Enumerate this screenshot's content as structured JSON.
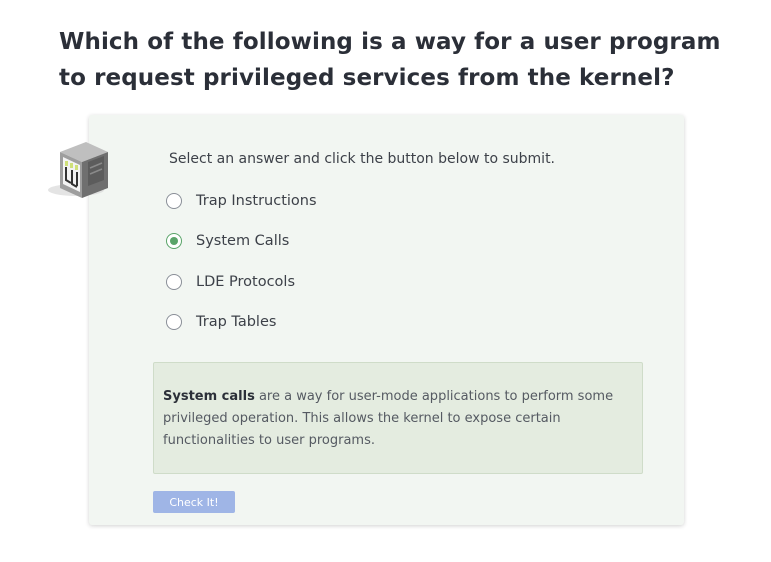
{
  "question": {
    "text": "Which of the following is a way for a user program to request privileged services from the kernel?"
  },
  "quiz": {
    "instructions": "Select an answer and click the button below to submit.",
    "options": [
      {
        "label": "Trap Instructions",
        "selected": false
      },
      {
        "label": "System Calls",
        "selected": true
      },
      {
        "label": "LDE Protocols",
        "selected": false
      },
      {
        "label": "Trap Tables",
        "selected": false
      }
    ],
    "feedback": {
      "term": "System calls",
      "text": " are a way for user-mode applications to perform some privileged operation. This allows the kernel to expose certain functionalities to user programs."
    },
    "submit_label": "Check It!"
  },
  "colors": {
    "card_bg": "#f2f6f2",
    "feedback_bg": "#e4ece0",
    "selected_radio": "#5aa469",
    "button_bg": "#9fb5e6"
  },
  "icons": {
    "illustration": "server-rack-icon"
  }
}
